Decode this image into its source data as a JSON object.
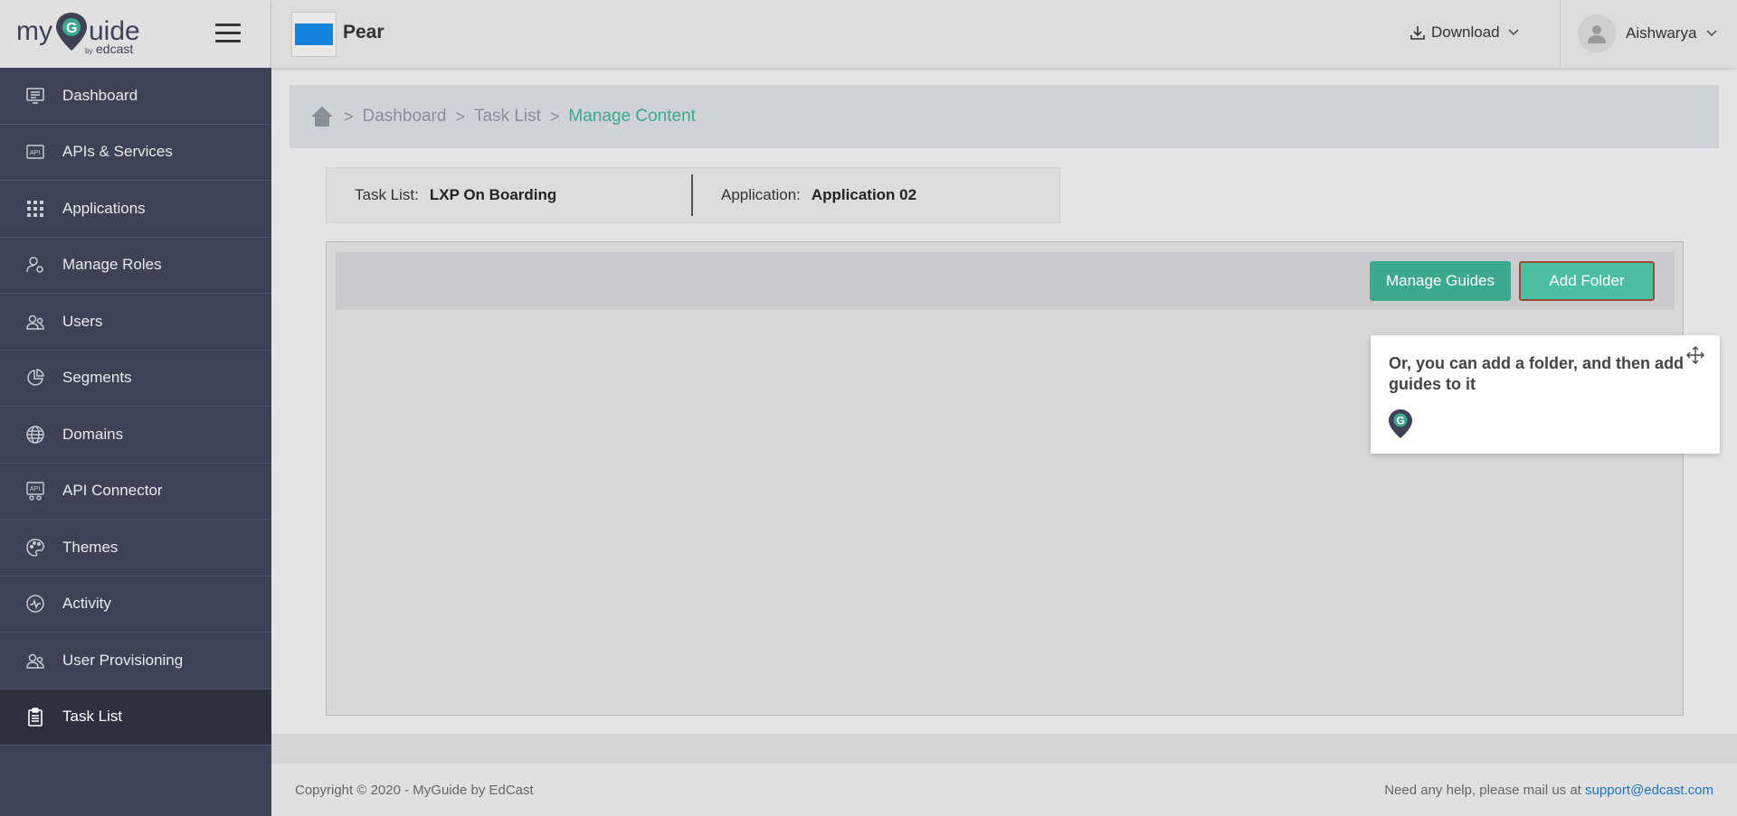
{
  "brand": {
    "logo_alt": "myGuide by edcast",
    "logo_word_left": "my",
    "logo_word_right": "uide",
    "logo_by": "by",
    "logo_sub": "edcast"
  },
  "sidebar": {
    "items": [
      {
        "label": "Dashboard",
        "icon": "dashboard-icon"
      },
      {
        "label": "APIs & Services",
        "icon": "api-icon"
      },
      {
        "label": "Applications",
        "icon": "grid-icon"
      },
      {
        "label": "Manage Roles",
        "icon": "user-gear-icon"
      },
      {
        "label": "Users",
        "icon": "users-icon"
      },
      {
        "label": "Segments",
        "icon": "pie-chart-icon"
      },
      {
        "label": "Domains",
        "icon": "globe-icon"
      },
      {
        "label": "API Connector",
        "icon": "api-connector-icon"
      },
      {
        "label": "Themes",
        "icon": "palette-icon"
      },
      {
        "label": "Activity",
        "icon": "activity-icon"
      },
      {
        "label": "User Provisioning",
        "icon": "users-icon"
      },
      {
        "label": "Task List",
        "icon": "clipboard-icon",
        "active": true
      }
    ]
  },
  "header": {
    "app_name": "Pear",
    "app_color": "#1482da",
    "download_label": "Download",
    "user_name": "Aishwarya"
  },
  "breadcrumb": {
    "items": [
      "Dashboard",
      "Task List"
    ],
    "current": "Manage Content"
  },
  "info": {
    "task_list_label": "Task List:",
    "task_list_value": "LXP On Boarding",
    "application_label": "Application:",
    "application_value": "Application 02"
  },
  "toolbar": {
    "manage_guides_label": "Manage Guides",
    "add_folder_label": "Add Folder"
  },
  "tooltip": {
    "text": "Or, you can add a folder, and then add guides to it"
  },
  "footer": {
    "copyright": "Copyright © 2020 - MyGuide by EdCast",
    "help_text": "Need any help, please mail us at",
    "help_email": "support@edcast.com"
  },
  "colors": {
    "accent": "#3aa98d",
    "sidebar_bg": "#3f4157",
    "sidebar_active": "#2e303f",
    "link": "#1a73c4"
  }
}
